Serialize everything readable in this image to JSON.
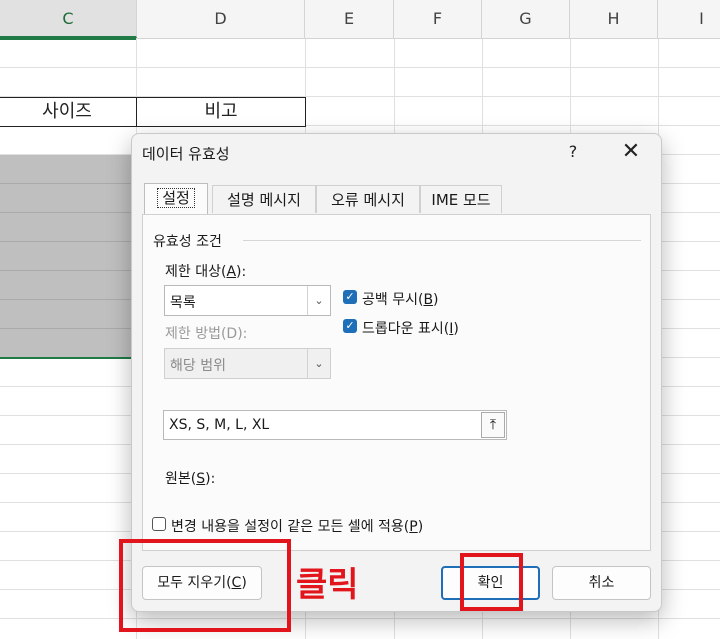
{
  "sheet": {
    "columns": [
      "C",
      "D",
      "E",
      "F",
      "G",
      "H",
      "I"
    ],
    "cells": {
      "size_header": "사이즈",
      "note_header": "비고"
    }
  },
  "dialog": {
    "title": "데이터 유효성",
    "help": "?",
    "close": "✕",
    "tabs": [
      "설정",
      "설명 메시지",
      "오류 메시지",
      "IME 모드"
    ],
    "group_label": "유효성 조건",
    "allow_label": "제한 대상(",
    "allow_key": "A",
    "allow_tail": "):",
    "allow_value": "목록",
    "data_label": "제한 방법(D):",
    "data_value": "해당 범위",
    "ignore_blank_label": "공백 무시(",
    "ignore_blank_key": "B",
    "ignore_blank_tail": ")",
    "ignore_blank_checked": true,
    "dropdown_label": "드롭다운 표시(",
    "dropdown_key": "I",
    "dropdown_tail": ")",
    "dropdown_checked": true,
    "source_label": "원본(",
    "source_key": "S",
    "source_tail": "):",
    "source_value": "XS, S, M, L, XL",
    "apply_all_label": "변경 내용을 설정이 같은 모든 셀에 적용(",
    "apply_all_key": "P",
    "apply_all_tail": ")",
    "apply_all_checked": false,
    "clear_all_label": "모두 지우기(",
    "clear_all_key": "C",
    "clear_all_tail": ")",
    "ok_label": "확인",
    "cancel_label": "취소"
  },
  "annotation": {
    "label": "클릭",
    "color": "#e2141c"
  },
  "colors": {
    "accent": "#1e6fb8",
    "excel_green": "#1f7a45"
  }
}
